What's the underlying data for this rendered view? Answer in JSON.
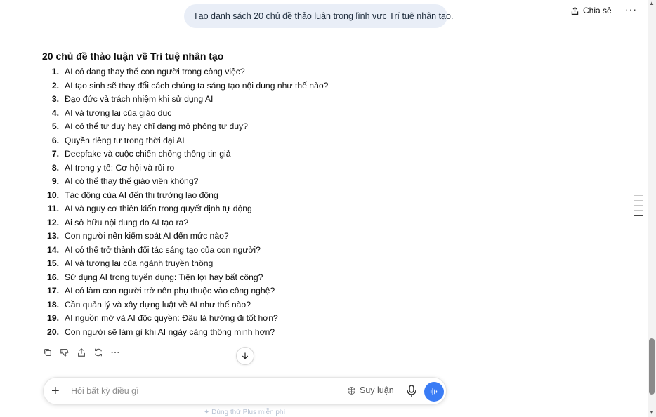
{
  "header": {
    "share_label": "Chia sẻ",
    "more_label": "···"
  },
  "user_message": "Tạo danh sách 20 chủ đề thảo luận trong lĩnh vực Trí tuệ nhân tạo.",
  "answer": {
    "title": "20 chủ đề thảo luận về Trí tuệ nhân tạo",
    "items": [
      {
        "num": "1.",
        "text": "AI có đang thay thế con người trong công việc?"
      },
      {
        "num": "2.",
        "text": "AI tạo sinh sẽ thay đổi cách chúng ta sáng tạo nội dung như thế nào?"
      },
      {
        "num": "3.",
        "text": "Đạo đức và trách nhiệm khi sử dụng AI"
      },
      {
        "num": "4.",
        "text": "AI và tương lai của giáo dục"
      },
      {
        "num": "5.",
        "text": "AI có thể tư duy hay chỉ đang mô phỏng tư duy?"
      },
      {
        "num": "6.",
        "text": "Quyền riêng tư trong thời đại AI"
      },
      {
        "num": "7.",
        "text": "Deepfake và cuộc chiến chống thông tin giả"
      },
      {
        "num": "8.",
        "text": "AI trong y tế: Cơ hội và rủi ro"
      },
      {
        "num": "9.",
        "text": "AI có thể thay thế giáo viên không?"
      },
      {
        "num": "10.",
        "text": "Tác động của AI đến thị trường lao động"
      },
      {
        "num": "11.",
        "text": "AI và nguy cơ thiên kiến trong quyết định tự động"
      },
      {
        "num": "12.",
        "text": "Ai sở hữu nội dung do AI tạo ra?"
      },
      {
        "num": "13.",
        "text": "Con người nên kiểm soát AI đến mức nào?"
      },
      {
        "num": "14.",
        "text": "AI có thể trở thành đối tác sáng tạo của con người?"
      },
      {
        "num": "15.",
        "text": "AI và tương lai của ngành truyền thông"
      },
      {
        "num": "16.",
        "text": "Sử dụng AI trong tuyển dụng: Tiện lợi hay bất công?"
      },
      {
        "num": "17.",
        "text": "AI có làm con người trở nên phụ thuộc vào công nghệ?"
      },
      {
        "num": "18.",
        "text": "Cần quản lý và xây dựng luật về AI như thế nào?"
      },
      {
        "num": "19.",
        "text": "AI nguồn mở và AI độc quyền: Đâu là hướng đi tốt hơn?"
      },
      {
        "num": "20.",
        "text": "Con người sẽ làm gì khi AI ngày càng thông minh hơn?"
      }
    ]
  },
  "action_icons": [
    "copy-icon",
    "thumbs-down-icon",
    "share-icon",
    "regenerate-icon",
    "more-icon"
  ],
  "composer": {
    "placeholder": "Hỏi bất kỳ điều gì",
    "reason_label": "Suy luận",
    "plus_label": "+"
  },
  "plus_hint": "✦ Dùng thử Plus miễn phí",
  "colors": {
    "bubble": "#e9eef7",
    "voice_button": "#3a7cf5"
  }
}
